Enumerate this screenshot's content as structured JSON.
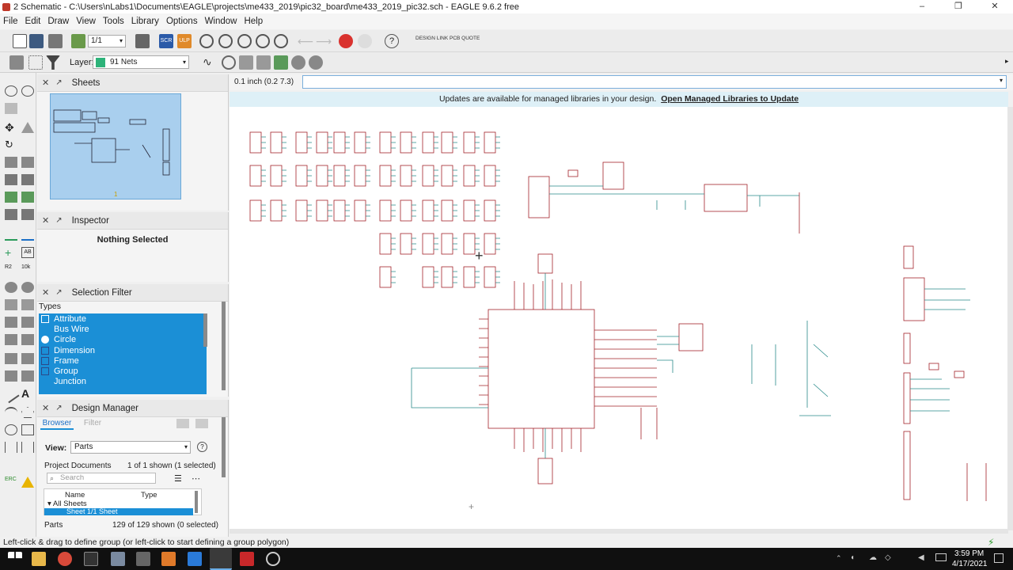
{
  "window": {
    "title": "2 Schematic - C:\\Users\\nLabs1\\Documents\\EAGLE\\projects\\me433_2019\\pic32_board\\me433_2019_pic32.sch - EAGLE 9.6.2 free",
    "minimize": "–",
    "maximize": "❐",
    "close": "✕"
  },
  "menu": [
    "File",
    "Edit",
    "Draw",
    "View",
    "Tools",
    "Library",
    "Options",
    "Window",
    "Help"
  ],
  "toolbar": {
    "sheet_value": "1/1",
    "design_link": "DESIGN LINK",
    "pcb_quote": "PCB QUOTE",
    "scr_label": "SCR",
    "ulp_label": "ULP",
    "help_glyph": "?"
  },
  "toolbar2": {
    "layer_label": "Layer:",
    "layer_value": "91 Nets",
    "layer_color": "#2eb37a"
  },
  "panels": {
    "sheets": {
      "title": "Sheets",
      "marker": "1"
    },
    "inspector": {
      "title": "Inspector",
      "status": "Nothing Selected"
    },
    "selection_filter": {
      "title": "Selection Filter",
      "types_label": "Types",
      "items": [
        "Attribute",
        "Bus Wire",
        "Circle",
        "Dimension",
        "Frame",
        "Group",
        "Junction"
      ]
    },
    "design_manager": {
      "title": "Design Manager",
      "tab_browser": "Browser",
      "tab_filter": "Filter",
      "view_label": "View:",
      "view_value": "Parts",
      "project_documents": "Project Documents",
      "project_count": "1 of 1 shown (1 selected)",
      "search_placeholder": "Search",
      "col_name": "Name",
      "col_type": "Type",
      "all_sheets": "All Sheets",
      "sheet_row": "Sheet 1/1  Sheet",
      "parts_label": "Parts",
      "parts_count": "129 of 129 shown (0 selected)"
    }
  },
  "canvas": {
    "coord_readout": "0.1 inch (0.2 7.3)",
    "banner_text": "Updates are available for managed libraries in your design.",
    "banner_link": "Open Managed Libraries to Update"
  },
  "status": "Left-click & drag to define group (or left-click to start defining a group polygon)",
  "taskbar": {
    "time": "3:59 PM",
    "date": "4/17/2021"
  },
  "colors": {
    "accent": "#1b8fd6",
    "banner": "#def0f7",
    "part_outline": "#a3242a",
    "net": "#2a8a8a"
  }
}
